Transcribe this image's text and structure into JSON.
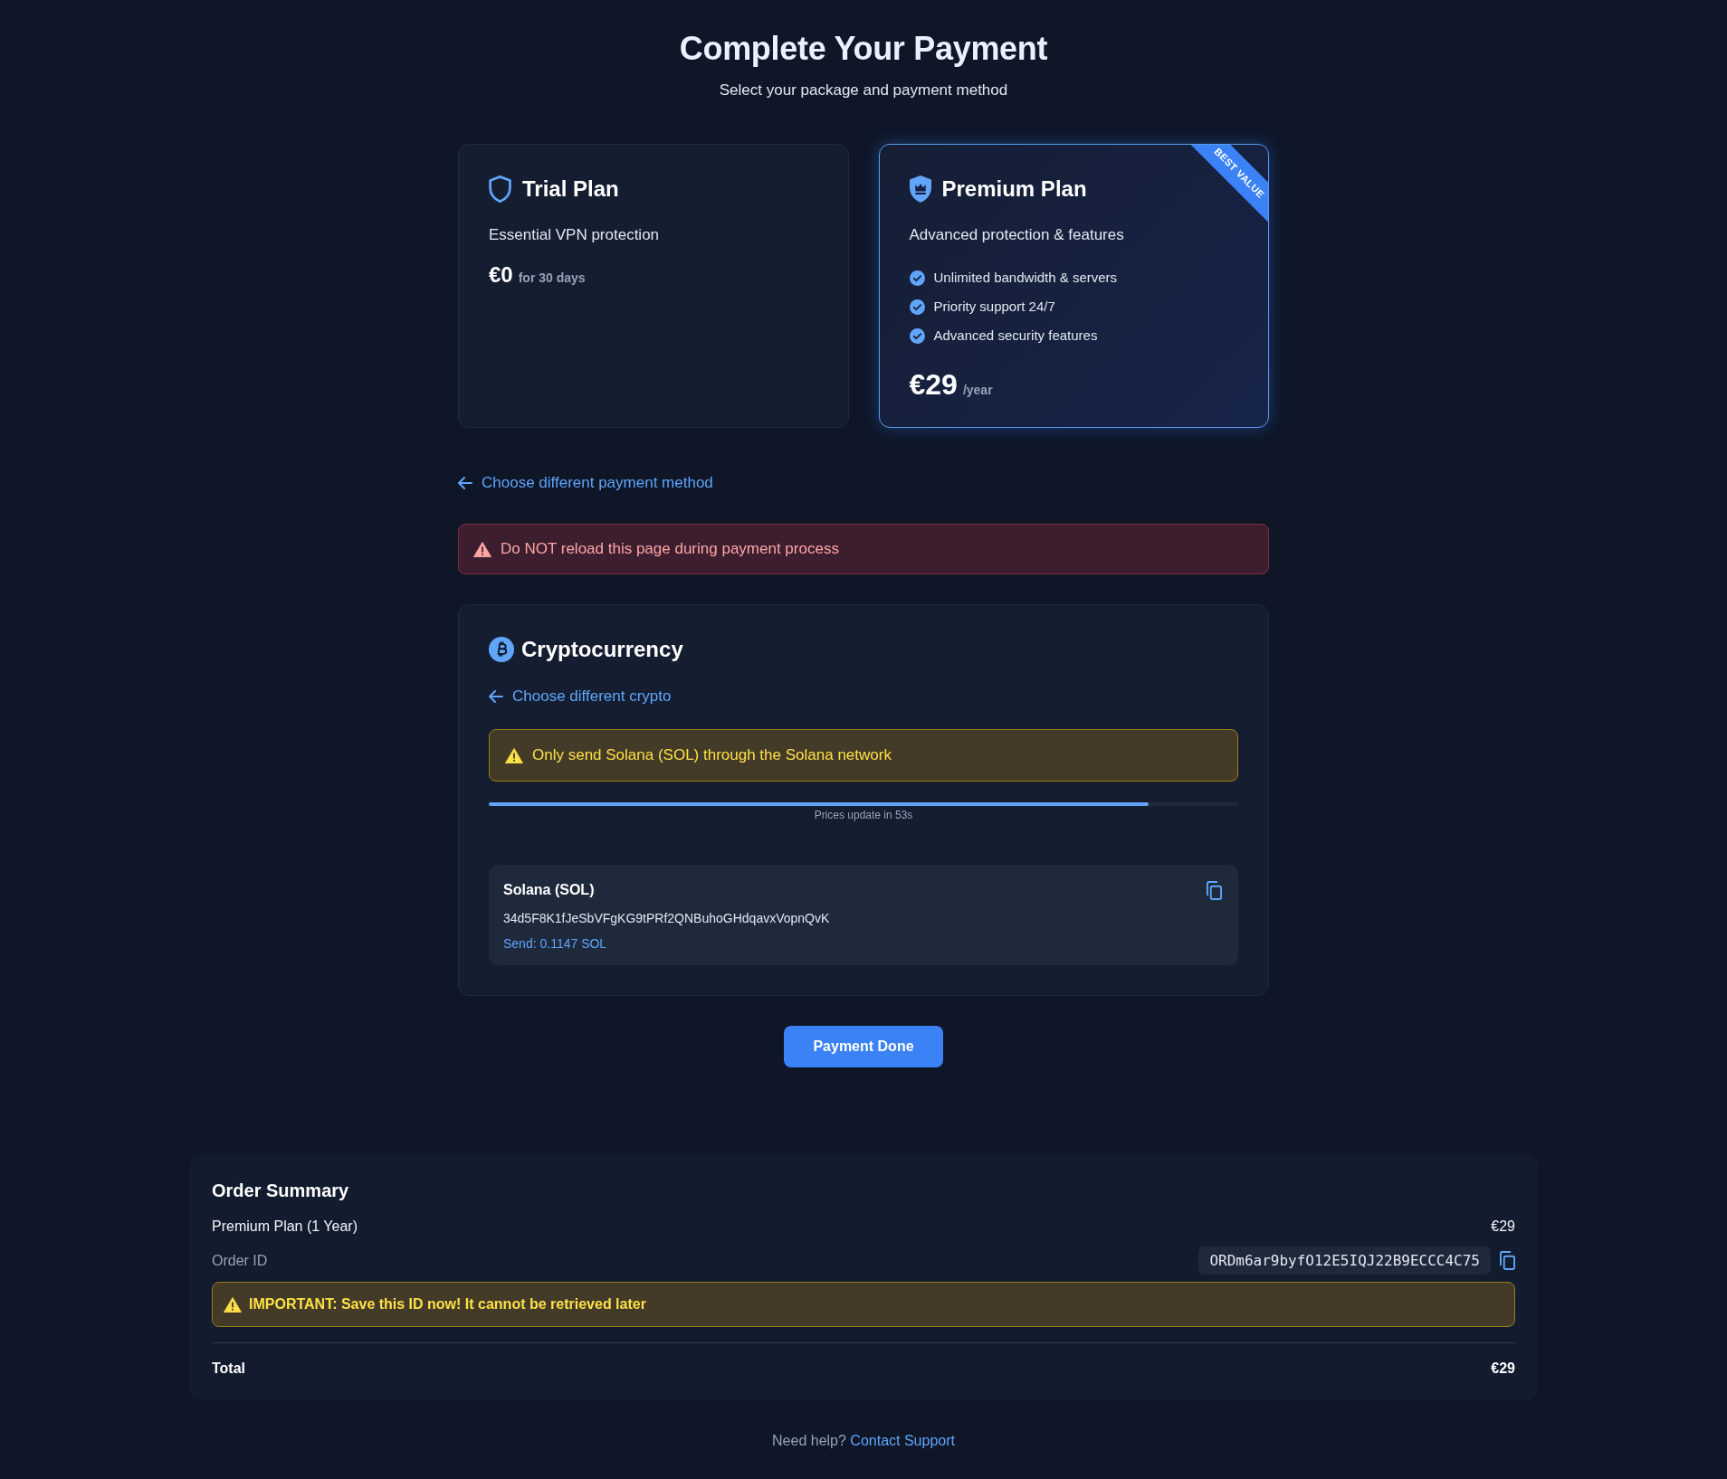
{
  "header": {
    "title": "Complete Your Payment",
    "subtitle": "Select your package and payment method"
  },
  "plans": [
    {
      "kind": "basic",
      "name": "Trial Plan",
      "selected": false,
      "description": "Essential VPN protection",
      "price": "€0",
      "period": "for 30 days"
    },
    {
      "kind": "premium",
      "name": "Premium Plan",
      "selected": true,
      "badge": "BEST VALUE",
      "description": "Advanced protection & features",
      "features": [
        "Unlimited bandwidth & servers",
        "Priority support 24/7",
        "Advanced security features"
      ],
      "price": "€29",
      "period": "/year"
    }
  ],
  "back_link": "Choose different payment method",
  "alert": {
    "kind": "danger",
    "text": "Do NOT reload this page during payment process"
  },
  "crypto": {
    "title": "Cryptocurrency",
    "back_link": "Choose different crypto",
    "warning": {
      "kind": "warning",
      "text": "Only send Solana (SOL) through the Solana network"
    },
    "timer": {
      "level": 0.88,
      "label": "Prices update in 53s"
    },
    "wallet": {
      "name": "Solana (SOL)",
      "address": "34d5F8K1fJeSbVFgKG9tPRf2QNBuhoGHdqavxVopnQvK",
      "amount": "Send: 0.1147 SOL"
    }
  },
  "submit_button": "Payment Done",
  "order_summary": {
    "title": "Order Summary",
    "item": {
      "label": "Premium Plan (1 Year)",
      "price": "€29"
    },
    "order_id": {
      "label": "Order ID",
      "value": "ORDm6ar9byfO12E5IQJ22B9ECCC4C75"
    },
    "notice": {
      "kind": "warning",
      "text": "IMPORTANT: Save this ID now! It cannot be retrieved later"
    },
    "total": {
      "label": "Total",
      "price": "€29"
    }
  },
  "footer": {
    "text": "Need help?",
    "link": "Contact Support"
  }
}
